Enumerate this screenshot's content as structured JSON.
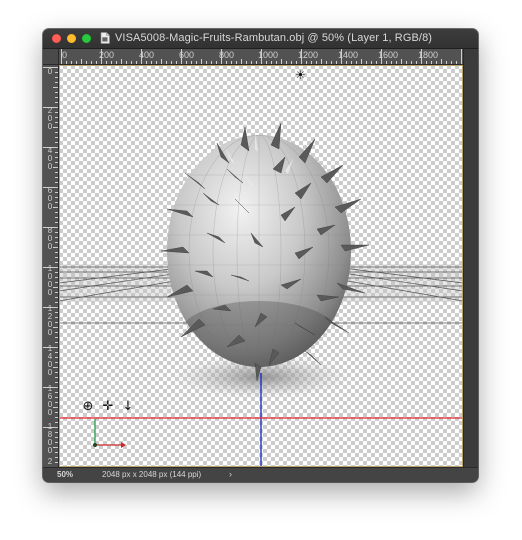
{
  "window": {
    "title": "VISA5008-Magic-Fruits-Rambutan.obj @ 50% (Layer 1, RGB/8)",
    "controls": {
      "close_color": "#ff5f57",
      "minimize_color": "#febc2e",
      "maximize_color": "#28c840"
    }
  },
  "rulers": {
    "horizontal_labels": [
      "0",
      "200",
      "400",
      "600",
      "800",
      "1000",
      "1200",
      "1400",
      "1600",
      "1800"
    ],
    "vertical_labels": [
      "0",
      "200",
      "400",
      "600",
      "800",
      "1000",
      "1200",
      "1400",
      "1600",
      "1800",
      "2"
    ]
  },
  "canvas": {
    "light_icon": "sun-icon",
    "gizmo_icons": [
      "orbit-icon",
      "move-icon",
      "arrow-down-icon"
    ],
    "ground_axis_color": "#e0242a",
    "vertical_axis_color": "#1e2ec8",
    "object_name": "rambutan-mesh"
  },
  "statusbar": {
    "zoom": "50%",
    "document_info": "2048 px x 2048 px (144 ppi)",
    "arrow": "›"
  }
}
